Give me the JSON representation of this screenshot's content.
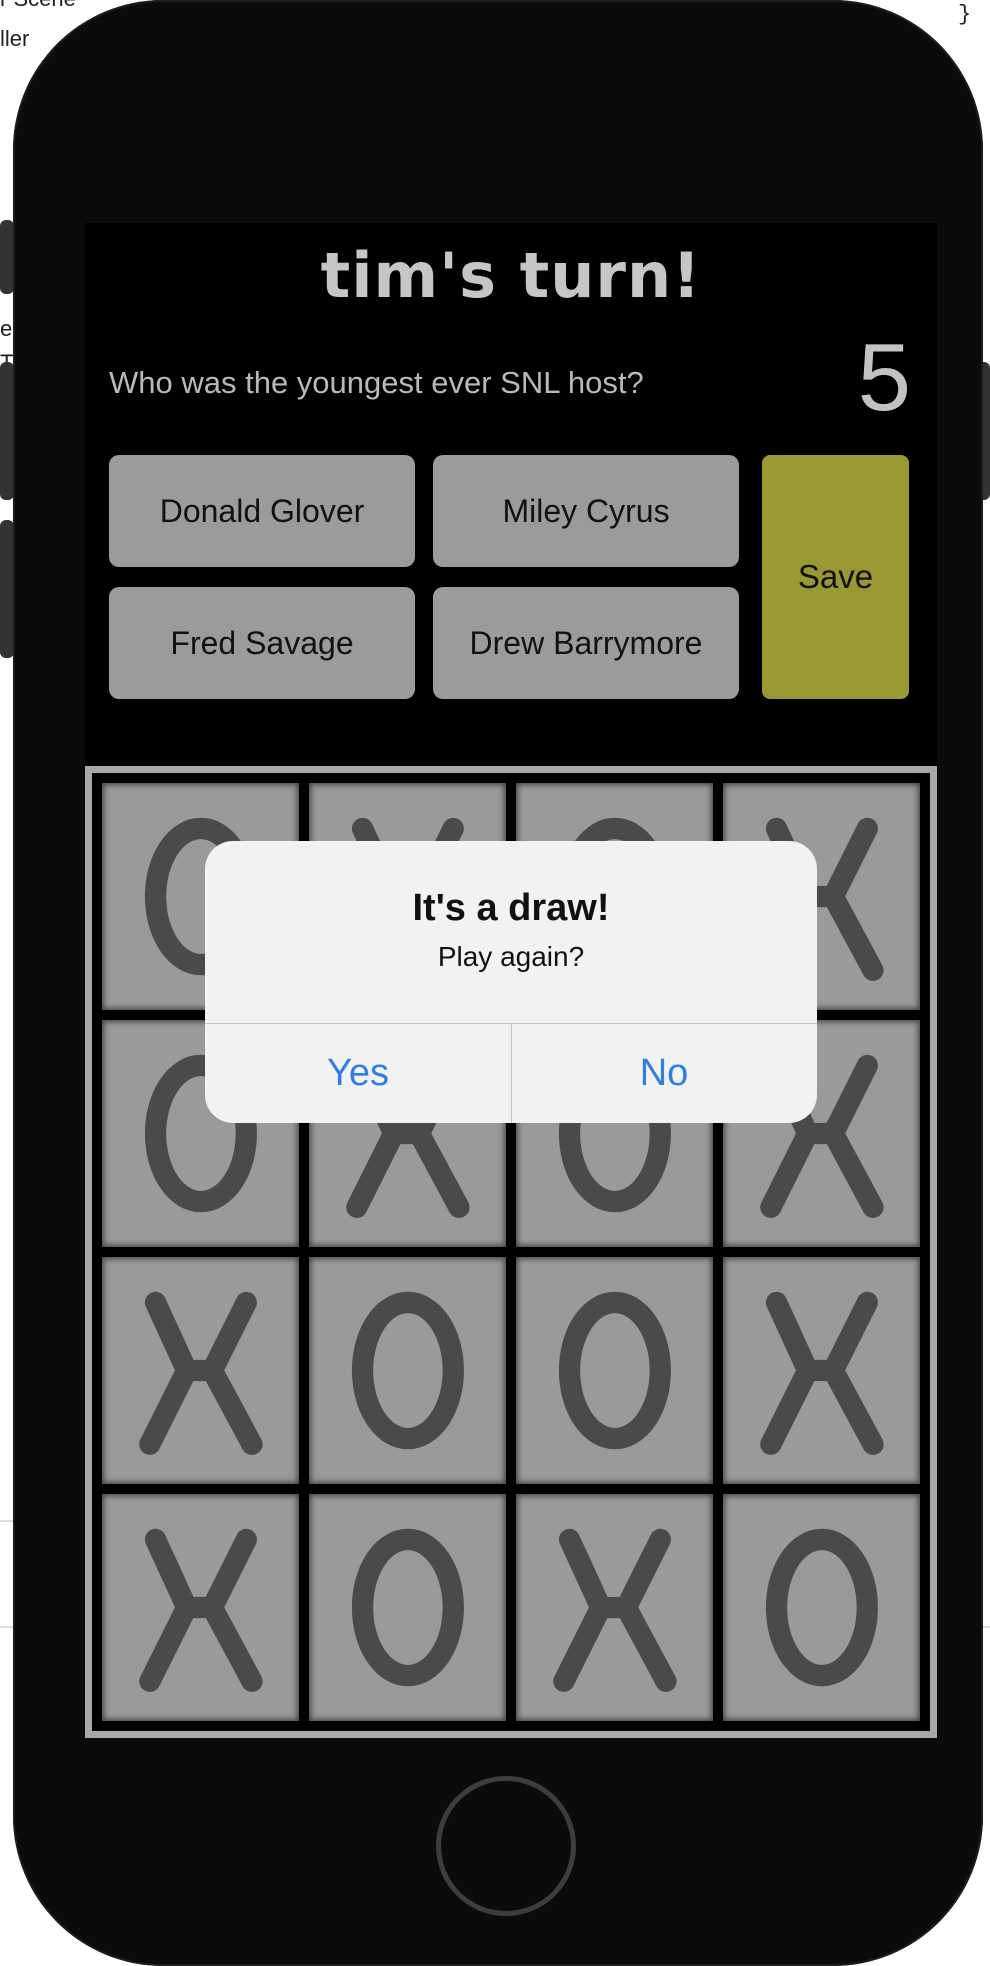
{
  "background": {
    "fragments": [
      "r Scene",
      "ller",
      "}",
      "er",
      "T"
    ]
  },
  "game": {
    "turn_title": "tim's turn!",
    "question": "Who was the youngest ever SNL host?",
    "timer": "5",
    "answers": [
      "Donald Glover",
      "Miley Cyrus",
      "Fred Savage",
      "Drew Barrymore"
    ],
    "save_label": "Save",
    "board": [
      [
        "O",
        "X",
        "O",
        "X"
      ],
      [
        "O",
        "X",
        "O",
        "X"
      ],
      [
        "X",
        "O",
        "O",
        "X"
      ],
      [
        "X",
        "O",
        "X",
        "O"
      ]
    ]
  },
  "alert": {
    "title": "It's a draw!",
    "message": "Play again?",
    "yes_label": "Yes",
    "no_label": "No"
  },
  "colors": {
    "alert_button": "#2f7ee6",
    "save_button": "#9a9833",
    "cell": "#9a9a9a",
    "mark": "#4a4a4a"
  }
}
